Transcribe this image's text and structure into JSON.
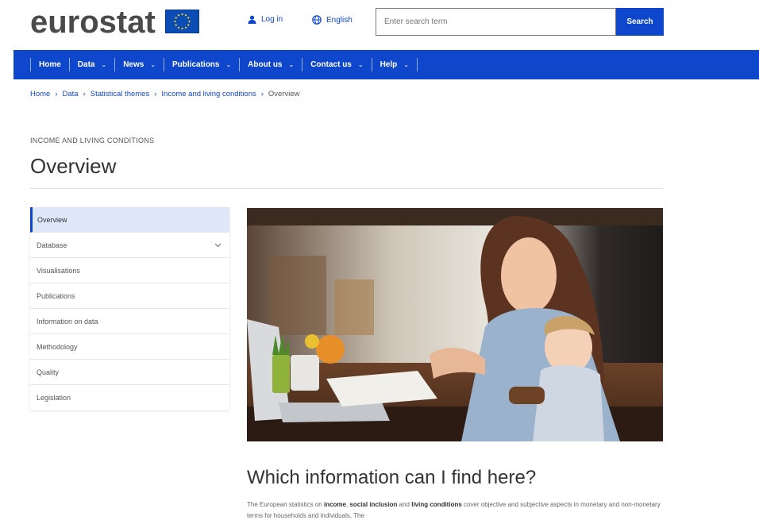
{
  "header": {
    "logo_text": "eurostat",
    "login_label": "Log in",
    "language_label": "English",
    "search_placeholder": "Enter search term",
    "search_button": "Search"
  },
  "nav": {
    "items": [
      {
        "label": "Home",
        "has_dropdown": false
      },
      {
        "label": "Data",
        "has_dropdown": true
      },
      {
        "label": "News",
        "has_dropdown": true
      },
      {
        "label": "Publications",
        "has_dropdown": true
      },
      {
        "label": "About us",
        "has_dropdown": true
      },
      {
        "label": "Contact us",
        "has_dropdown": true
      },
      {
        "label": "Help",
        "has_dropdown": true
      }
    ]
  },
  "breadcrumb": {
    "items": [
      "Home",
      "Data",
      "Statistical themes",
      "Income and living conditions"
    ],
    "current": "Overview"
  },
  "page": {
    "kicker": "INCOME AND LIVING CONDITIONS",
    "title": "Overview"
  },
  "side_menu": {
    "items": [
      {
        "label": "Overview",
        "active": true,
        "expandable": false
      },
      {
        "label": "Database",
        "active": false,
        "expandable": true
      },
      {
        "label": "Visualisations",
        "active": false,
        "expandable": false
      },
      {
        "label": "Publications",
        "active": false,
        "expandable": false
      },
      {
        "label": "Information on data",
        "active": false,
        "expandable": false
      },
      {
        "label": "Methodology",
        "active": false,
        "expandable": false
      },
      {
        "label": "Quality",
        "active": false,
        "expandable": false
      },
      {
        "label": "Legislation",
        "active": false,
        "expandable": false
      }
    ]
  },
  "content": {
    "heading": "Which information can I find here?",
    "para_1": "The European statistics on ",
    "para_b1": "income",
    "para_2": ", ",
    "para_b2": "social inclusion",
    "para_3": " and ",
    "para_b3": "living conditions",
    "para_4": " cover objective and subjective aspects in monetary and non-monetary terms for households and individuals. The"
  },
  "colors": {
    "brand_blue": "#0e47cb",
    "eu_flag_blue": "#0b4db4",
    "eu_star_yellow": "#ffd617"
  }
}
